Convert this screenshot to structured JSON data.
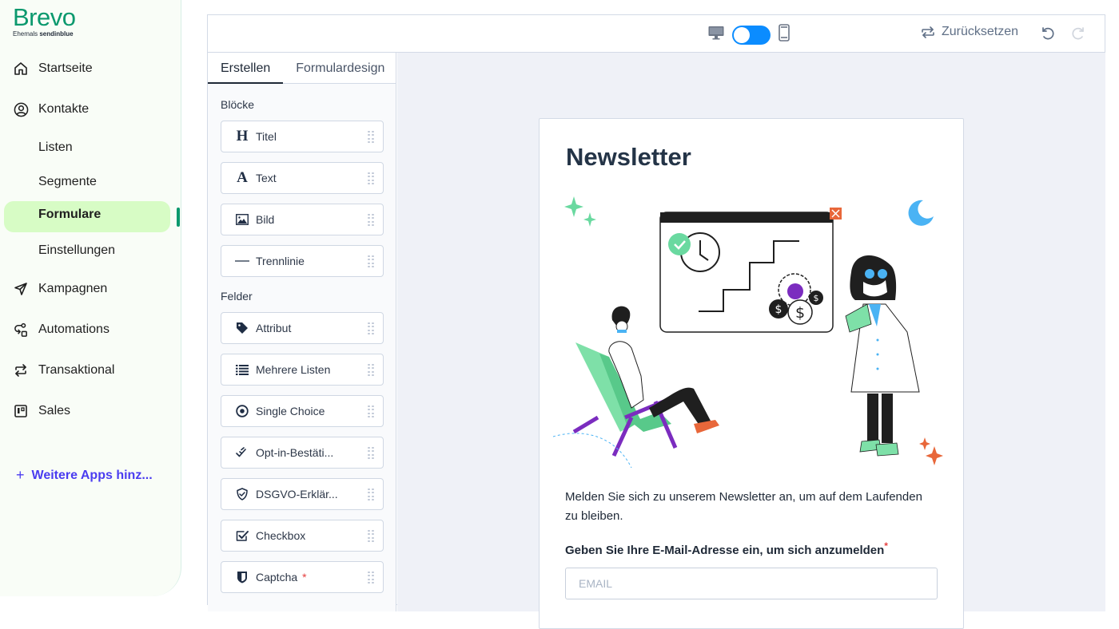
{
  "brand": {
    "name": "Brevo",
    "tagline_prefix": "Ehemals",
    "tagline_brand": "sendinblue",
    "color": "#0b996e"
  },
  "sidebar": {
    "items": [
      {
        "label": "Startseite",
        "icon": "home-icon"
      },
      {
        "label": "Kontakte",
        "icon": "user-circle-icon"
      },
      {
        "label": "Kampagnen",
        "icon": "send-icon"
      },
      {
        "label": "Automations",
        "icon": "automation-icon"
      },
      {
        "label": "Transaktional",
        "icon": "transfer-icon"
      },
      {
        "label": "Sales",
        "icon": "kanban-icon"
      }
    ],
    "contacts_sub": [
      {
        "label": "Listen"
      },
      {
        "label": "Segmente"
      },
      {
        "label": "Formulare",
        "active": true
      },
      {
        "label": "Einstellungen"
      }
    ],
    "add_apps_label": "Weitere Apps hinz...",
    "active_color": "#d7fcc5",
    "add_apps_color": "#4a3cf0"
  },
  "toolbar": {
    "view_mode": "desktop",
    "toggle_color": "#0b8cff",
    "reset_label": "Zurücksetzen",
    "undo_label": "undo",
    "redo_label": "redo"
  },
  "panel": {
    "tabs": [
      {
        "label": "Erstellen",
        "active": true
      },
      {
        "label": "Formulardesign",
        "active": false
      }
    ],
    "blocks_heading": "Blöcke",
    "blocks": [
      {
        "label": "Titel",
        "icon": "heading-icon"
      },
      {
        "label": "Text",
        "icon": "text-icon"
      },
      {
        "label": "Bild",
        "icon": "image-icon"
      },
      {
        "label": "Trennlinie",
        "icon": "divider-icon"
      }
    ],
    "fields_heading": "Felder",
    "fields": [
      {
        "label": "Attribut",
        "icon": "tag-icon"
      },
      {
        "label": "Mehrere Listen",
        "icon": "list-icon"
      },
      {
        "label": "Single Choice",
        "icon": "radio-icon"
      },
      {
        "label": "Opt-in-Bestäti...",
        "icon": "double-check-icon"
      },
      {
        "label": "DSGVO-Erklär...",
        "icon": "shield-check-icon"
      },
      {
        "label": "Checkbox",
        "icon": "checkbox-icon"
      },
      {
        "label": "Captcha",
        "icon": "shield-icon",
        "required_mark": "*"
      }
    ]
  },
  "form": {
    "title": "Newsletter",
    "description": "Melden Sie sich zu unserem Newsletter an, um auf dem Laufenden zu bleiben.",
    "email_label": "Geben Sie Ihre E-Mail-Adresse ein, um sich anzumelden",
    "email_required_mark": "*",
    "email_placeholder": "EMAIL",
    "email_value": ""
  }
}
